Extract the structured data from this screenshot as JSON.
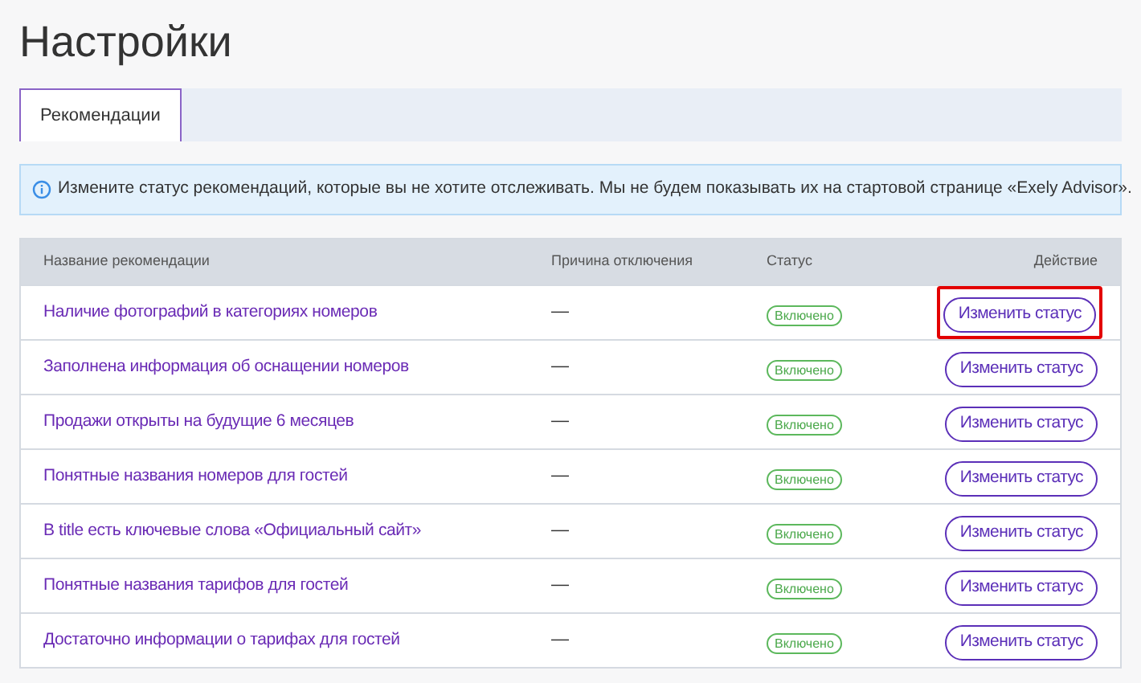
{
  "title": "Настройки",
  "tabs": [
    {
      "label": "Рекомендации",
      "selected": true
    }
  ],
  "info": "Измените статус рекомендаций, которые вы не хотите отслеживать. Мы не будем показывать их на стартовой странице «Exely Advisor».",
  "table": {
    "columns": [
      "Название рекомендации",
      "Причина отключения",
      "Статус",
      "Действие"
    ],
    "rows": [
      {
        "name": "Наличие фотографий в категориях номеров",
        "reason": "—",
        "status": "Включено",
        "action": "Изменить статус",
        "highlighted": true
      },
      {
        "name": "Заполнена информация об оснащении номеров",
        "reason": "—",
        "status": "Включено",
        "action": "Изменить статус",
        "highlighted": false
      },
      {
        "name": "Продажи открыты на будущие 6 месяцев",
        "reason": "—",
        "status": "Включено",
        "action": "Изменить статус",
        "highlighted": false
      },
      {
        "name": "Понятные названия номеров для гостей",
        "reason": "—",
        "status": "Включено",
        "action": "Изменить статус",
        "highlighted": false
      },
      {
        "name": "В title есть ключевые слова «Официальный сайт»",
        "reason": "—",
        "status": "Включено",
        "action": "Изменить статус",
        "highlighted": false
      },
      {
        "name": "Понятные названия тарифов для гостей",
        "reason": "—",
        "status": "Включено",
        "action": "Изменить статус",
        "highlighted": false
      },
      {
        "name": "Достаточно информации о тарифах для гостей",
        "reason": "—",
        "status": "Включено",
        "action": "Изменить статус",
        "highlighted": false
      }
    ]
  }
}
